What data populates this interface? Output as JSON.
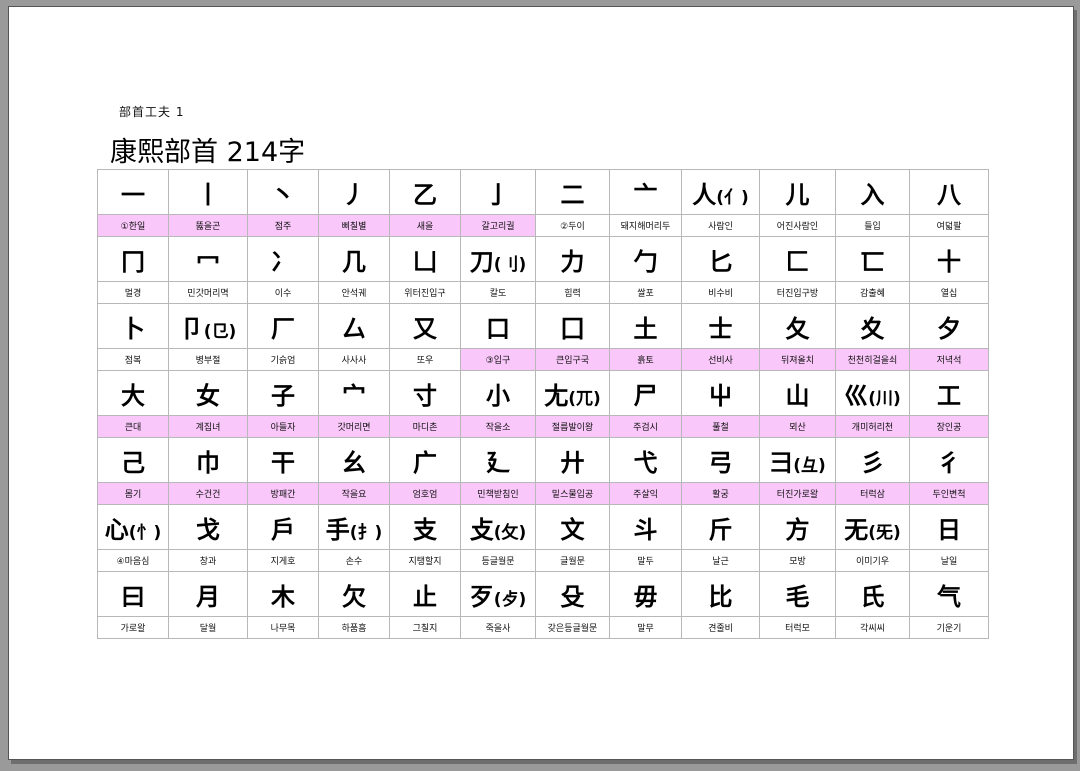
{
  "header": {
    "subtitle": "部首工夫 1",
    "title": "康熙部首  214字"
  },
  "table": {
    "rows": [
      {
        "chars": [
          "一",
          "丨",
          "丶",
          "丿",
          "乙",
          "亅",
          "二",
          "亠",
          "人",
          "儿",
          "入",
          "八"
        ],
        "variants": [
          "",
          "",
          "",
          "",
          "",
          "",
          "",
          "",
          "(亻)",
          "",
          "",
          ""
        ],
        "names": [
          "①한일",
          "뚫을곤",
          "점주",
          "삐칠별",
          "새을",
          "갈고리궐",
          "②두이",
          "돼지해머리두",
          "사람인",
          "어진사람인",
          "들입",
          "여덟팔"
        ],
        "highlight": [
          true,
          true,
          true,
          true,
          true,
          true,
          false,
          false,
          false,
          false,
          false,
          false
        ]
      },
      {
        "chars": [
          "冂",
          "冖",
          "冫",
          "几",
          "凵",
          "刀",
          "力",
          "勹",
          "匕",
          "匚",
          "匸",
          "十"
        ],
        "variants": [
          "",
          "",
          "",
          "",
          "",
          "(刂)",
          "",
          "",
          "",
          "",
          "",
          ""
        ],
        "names": [
          "멀경",
          "민갓머리멱",
          "이수",
          "안석궤",
          "위터진입구",
          "칼도",
          "힘력",
          "쌀포",
          "비수비",
          "터진입구방",
          "감출혜",
          "열십"
        ],
        "highlight": [
          false,
          false,
          false,
          false,
          false,
          false,
          false,
          false,
          false,
          false,
          false,
          false
        ]
      },
      {
        "chars": [
          "卜",
          "卩",
          "厂",
          "厶",
          "又",
          "口",
          "囗",
          "土",
          "士",
          "夂",
          "夊",
          "夕"
        ],
        "variants": [
          "",
          "(㔾)",
          "",
          "",
          "",
          "",
          "",
          "",
          "",
          "",
          "",
          ""
        ],
        "names": [
          "점복",
          "병부절",
          "기슭엄",
          "사사사",
          "또우",
          "③입구",
          "큰입구국",
          "흙토",
          "선비사",
          "뒤져올치",
          "천천히걸을쇠",
          "저녁석"
        ],
        "highlight": [
          false,
          false,
          false,
          false,
          false,
          true,
          true,
          true,
          true,
          true,
          true,
          true
        ]
      },
      {
        "chars": [
          "大",
          "女",
          "子",
          "宀",
          "寸",
          "小",
          "尢",
          "尸",
          "屮",
          "山",
          "巛",
          "工"
        ],
        "variants": [
          "",
          "",
          "",
          "",
          "",
          "",
          "(兀)",
          "",
          "",
          "",
          "(川)",
          ""
        ],
        "names": [
          "큰대",
          "계집녀",
          "아들자",
          "갓머리면",
          "마디촌",
          "작을소",
          "절름발이왕",
          "주검시",
          "풀철",
          "뫼산",
          "개미허리천",
          "장인공"
        ],
        "highlight": [
          true,
          true,
          true,
          true,
          true,
          true,
          true,
          true,
          true,
          true,
          true,
          true
        ]
      },
      {
        "chars": [
          "己",
          "巾",
          "干",
          "幺",
          "广",
          "廴",
          "廾",
          "弋",
          "弓",
          "彐",
          "彡",
          "彳"
        ],
        "variants": [
          "",
          "",
          "",
          "",
          "",
          "",
          "",
          "",
          "",
          "(彑)",
          "",
          ""
        ],
        "names": [
          "몸기",
          "수건건",
          "방패간",
          "작을요",
          "엄호엄",
          "민책받침인",
          "밑스물입공",
          "주살익",
          "활궁",
          "터진가로왈",
          "터럭삼",
          "두인변척"
        ],
        "highlight": [
          true,
          true,
          true,
          true,
          true,
          true,
          true,
          true,
          true,
          true,
          true,
          true
        ]
      },
      {
        "chars": [
          "心",
          "戈",
          "戶",
          "手",
          "支",
          "攴",
          "文",
          "斗",
          "斤",
          "方",
          "无",
          "日"
        ],
        "variants": [
          "(忄)",
          "",
          "",
          "(扌)",
          "",
          "(攵)",
          "",
          "",
          "",
          "",
          "(旡)",
          ""
        ],
        "names": [
          "④마음심",
          "창과",
          "지게호",
          "손수",
          "지탱할지",
          "등글월문",
          "글월문",
          "말두",
          "날근",
          "모방",
          "이미기우",
          "날일"
        ],
        "highlight": [
          false,
          false,
          false,
          false,
          false,
          false,
          false,
          false,
          false,
          false,
          false,
          false
        ]
      },
      {
        "chars": [
          "曰",
          "月",
          "木",
          "欠",
          "止",
          "歹",
          "殳",
          "毋",
          "比",
          "毛",
          "氏",
          "气"
        ],
        "variants": [
          "",
          "",
          "",
          "",
          "",
          "(歺)",
          "",
          "",
          "",
          "",
          "",
          ""
        ],
        "names": [
          "가로왈",
          "달월",
          "나무목",
          "하품흠",
          "그칠지",
          "죽을사",
          "갖은등글월문",
          "말무",
          "견줄비",
          "터럭모",
          "각씨씨",
          "기운기"
        ],
        "highlight": [
          false,
          false,
          false,
          false,
          false,
          false,
          false,
          false,
          false,
          false,
          false,
          false
        ]
      }
    ]
  }
}
